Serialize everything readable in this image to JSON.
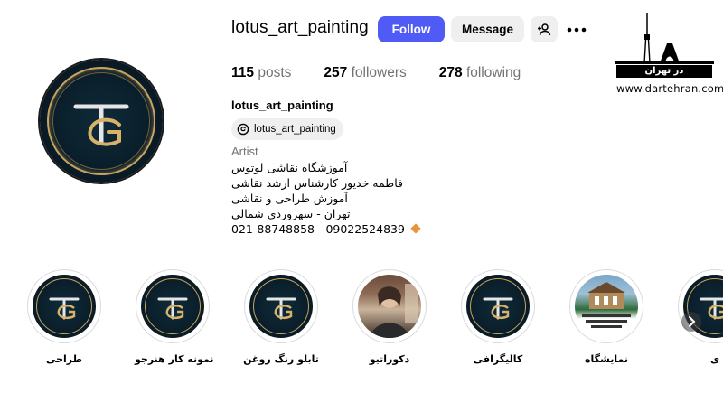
{
  "profile": {
    "username": "lotus_art_painting",
    "follow_label": "Follow",
    "message_label": "Message",
    "stats": {
      "posts_count": "115",
      "posts_label": "posts",
      "followers_count": "257",
      "followers_label": "followers",
      "following_count": "278",
      "following_label": "following"
    },
    "full_name": "lotus_art_painting",
    "threads_handle": "lotus_art_painting",
    "category": "Artist",
    "bio_lines": [
      "آموزشگاه نقاشی لوتوس",
      "فاطمه خدیور کارشناس ارشد نقاشی",
      "آموزش طراحی و نقاشی",
      "تهران - سهروردي شمالی",
      "021-88748858 - 09022524839"
    ]
  },
  "highlights": [
    {
      "label": "طراحی",
      "image": "lotus-logo"
    },
    {
      "label": "نمونه کار هنرجو",
      "image": "lotus-logo"
    },
    {
      "label": "تابلو رنگ روغن",
      "image": "lotus-logo"
    },
    {
      "label": "دکوراتیو",
      "image": "portrait-photo"
    },
    {
      "label": "کالیگرافی",
      "image": "lotus-logo"
    },
    {
      "label": "نمایشگاه",
      "image": "exhibition-poster"
    },
    {
      "label": "ی",
      "image": "lotus-logo"
    }
  ],
  "watermark": {
    "logo_text": "در تهران",
    "url": "www.dartehran.com"
  },
  "colors": {
    "follow_button": "#4f5bf4",
    "secondary_button": "#efefef",
    "muted_text": "#737373",
    "gold": "#c9a45c",
    "avatar_bg": "#0a1e2a"
  },
  "icons": {
    "add_user": "person-plus-icon",
    "more": "more-dots-icon",
    "threads": "threads-icon",
    "next": "chevron-right-icon"
  }
}
